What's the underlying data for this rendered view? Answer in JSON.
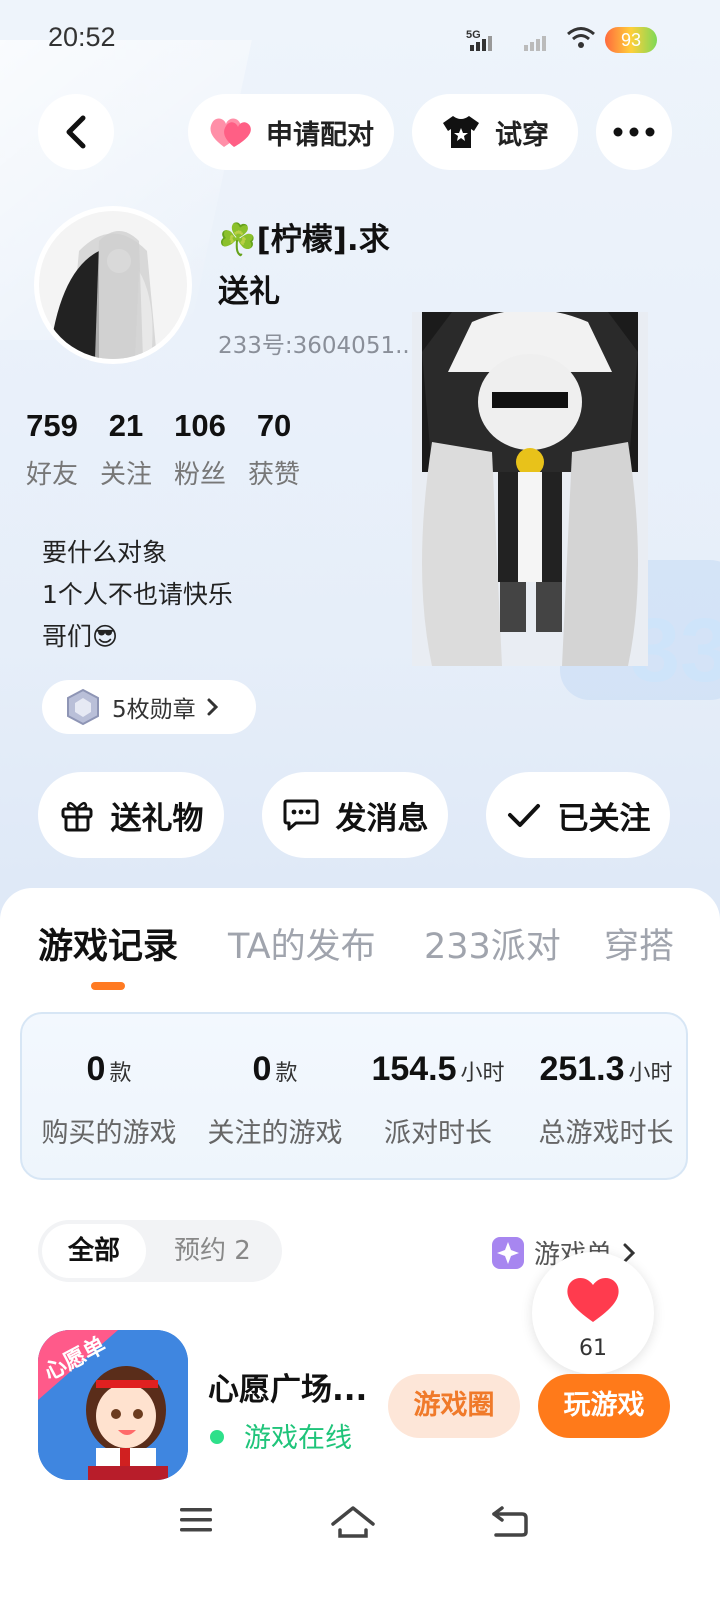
{
  "status_bar": {
    "time": "20:52",
    "network": "5G",
    "battery": "93"
  },
  "top_bar": {
    "pair_label": "申请配对",
    "try_on_label": "试穿"
  },
  "profile": {
    "nickname": "☘️[柠檬].求送礼",
    "uid": "233号:3604051...",
    "stats": [
      {
        "value": "759",
        "label": "好友"
      },
      {
        "value": "21",
        "label": "关注"
      },
      {
        "value": "106",
        "label": "粉丝"
      },
      {
        "value": "70",
        "label": "获赞"
      }
    ],
    "bio_lines": [
      "要什么对象",
      "1个人不也请快乐",
      "哥们😎"
    ],
    "badges_label": "5枚勋章"
  },
  "actions": {
    "gift": "送礼物",
    "message": "发消息",
    "follow": "已关注"
  },
  "tabs": [
    {
      "label": "游戏记录",
      "active": true
    },
    {
      "label": "TA的发布",
      "active": false
    },
    {
      "label": "233派对",
      "active": false
    },
    {
      "label": "穿搭",
      "active": false
    }
  ],
  "game_stats": [
    {
      "value": "0",
      "unit": "款",
      "label": "购买的游戏"
    },
    {
      "value": "0",
      "unit": "款",
      "label": "关注的游戏"
    },
    {
      "value": "154.5",
      "unit": "小时",
      "label": "派对时长"
    },
    {
      "value": "251.3",
      "unit": "小时",
      "label": "总游戏时长"
    }
  ],
  "filter": {
    "all": "全部",
    "reserved": "预约 2"
  },
  "game_list_link": "游戏单",
  "like_count": "61",
  "game": {
    "icon_text": "心愿单",
    "title": "心愿广场...",
    "status": "游戏在线",
    "circle_label": "游戏圈",
    "play_label": "玩游戏"
  },
  "colors": {
    "accent": "#ff7a1a",
    "online": "#1fc47a",
    "heart": "#ff3b4e"
  }
}
